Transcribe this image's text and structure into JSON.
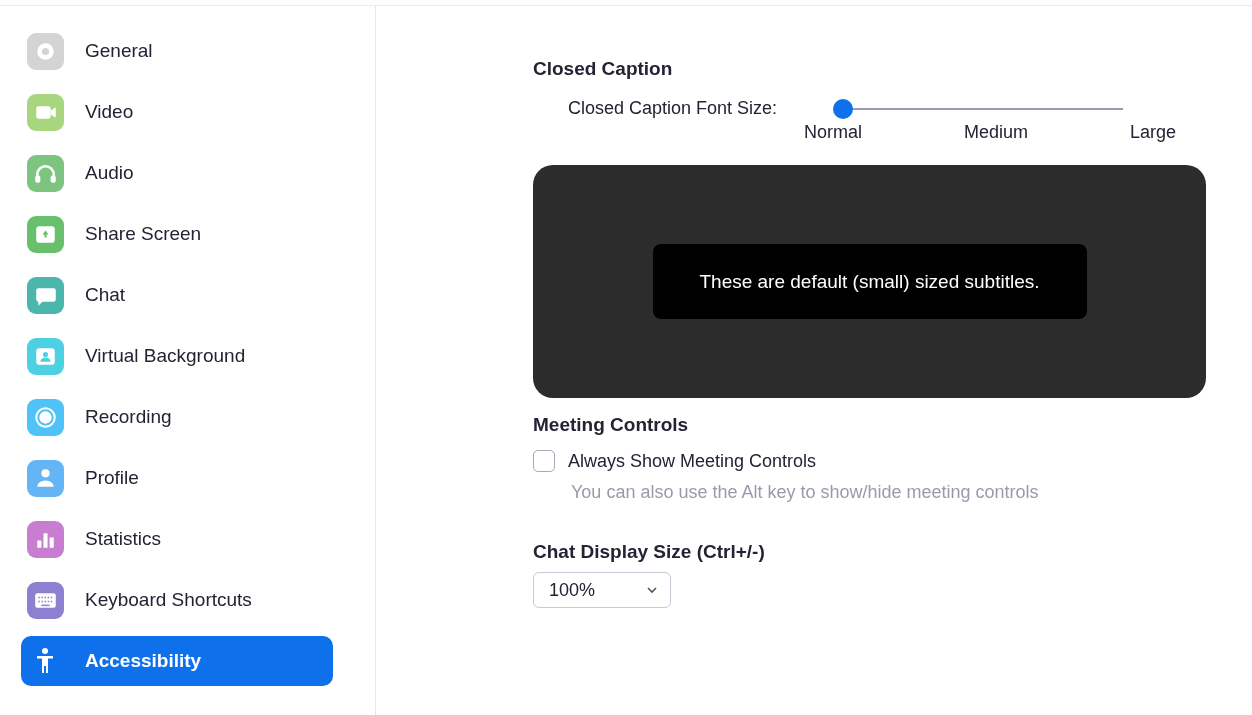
{
  "sidebar": {
    "items": [
      {
        "label": "General",
        "kind": "gear",
        "color": "#d4d4d4",
        "selected": false
      },
      {
        "label": "Video",
        "kind": "camera",
        "color": "#a8d67e",
        "selected": false
      },
      {
        "label": "Audio",
        "kind": "headphones",
        "color": "#7cc47f",
        "selected": false
      },
      {
        "label": "Share Screen",
        "kind": "share",
        "color": "#68c06c",
        "selected": false
      },
      {
        "label": "Chat",
        "kind": "chat",
        "color": "#4db6ac",
        "selected": false
      },
      {
        "label": "Virtual Background",
        "kind": "background",
        "color": "#4dd0e1",
        "selected": false
      },
      {
        "label": "Recording",
        "kind": "record",
        "color": "#4fc3f7",
        "selected": false
      },
      {
        "label": "Profile",
        "kind": "profile",
        "color": "#64b5f6",
        "selected": false
      },
      {
        "label": "Statistics",
        "kind": "stats",
        "color": "#c77dd0",
        "selected": false
      },
      {
        "label": "Keyboard Shortcuts",
        "kind": "keyboard",
        "color": "#8f7fd1",
        "selected": false
      },
      {
        "label": "Accessibility",
        "kind": "accessibility",
        "selected": true
      }
    ]
  },
  "closed_caption": {
    "heading": "Closed Caption",
    "font_size": {
      "label": "Closed Caption Font Size:",
      "level": 0,
      "ticks": [
        "Normal",
        "Medium",
        "Large"
      ]
    },
    "preview_text": "These are default (small) sized subtitles."
  },
  "meeting_controls": {
    "heading": "Meeting Controls",
    "option": {
      "label": "Always Show Meeting Controls",
      "checked": false
    },
    "hint": "You can also use the Alt key to show/hide meeting controls"
  },
  "chat_display": {
    "heading": "Chat Display Size (Ctrl+/-)",
    "value": "100%"
  }
}
